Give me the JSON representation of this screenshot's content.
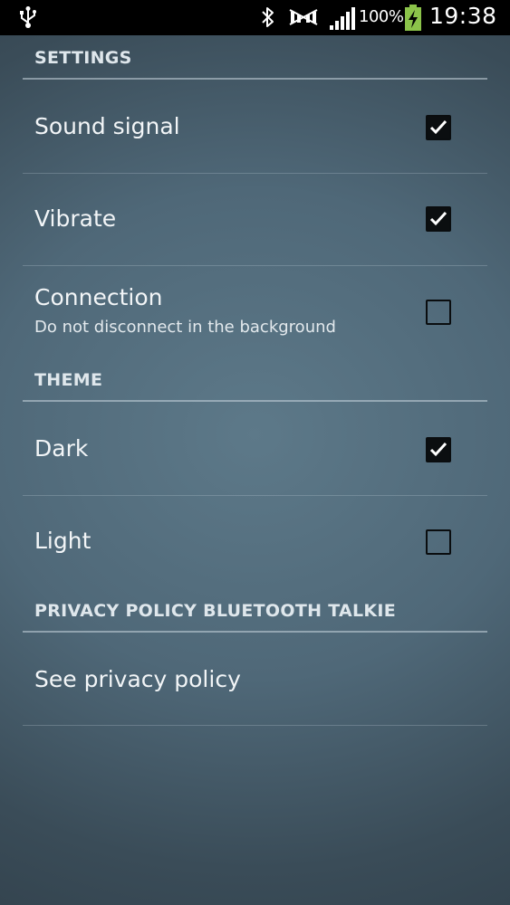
{
  "status_bar": {
    "battery_percent": "100%",
    "time": "19:38",
    "icons": [
      "usb-icon",
      "bluetooth-icon",
      "no-sim-icon",
      "signal-icon",
      "battery-charging-icon"
    ]
  },
  "sections": {
    "settings": {
      "header": "SETTINGS",
      "items": [
        {
          "title": "Sound signal",
          "checked": true
        },
        {
          "title": "Vibrate",
          "checked": true
        },
        {
          "title": "Connection",
          "subtitle": "Do not disconnect in the background",
          "checked": false
        }
      ]
    },
    "theme": {
      "header": "THEME",
      "items": [
        {
          "title": "Dark",
          "checked": true
        },
        {
          "title": "Light",
          "checked": false
        }
      ]
    },
    "privacy": {
      "header": "PRIVACY POLICY BLUETOOTH TALKIE",
      "items": [
        {
          "title": "See privacy policy"
        }
      ]
    }
  }
}
